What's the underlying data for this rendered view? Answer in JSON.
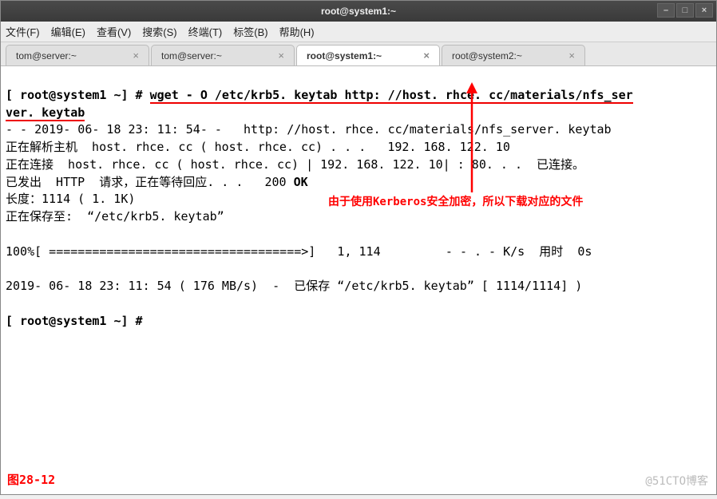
{
  "titlebar": {
    "title": "root@system1:~"
  },
  "winbuttons": {
    "min": "–",
    "max": "□",
    "close": "×"
  },
  "menu": {
    "file": "文件(F)",
    "edit": "编辑(E)",
    "view": "查看(V)",
    "search": "搜索(S)",
    "term": "终端(T)",
    "tabs": "标签(B)",
    "help": "帮助(H)"
  },
  "tabs": [
    {
      "label": "tom@server:~",
      "active": false
    },
    {
      "label": "tom@server:~",
      "active": false
    },
    {
      "label": "root@system1:~",
      "active": true
    },
    {
      "label": "root@system2:~",
      "active": false
    }
  ],
  "tab_close": "×",
  "terminal": {
    "prompt1_a": "[ root@system1 ~] # ",
    "cmd_part1": "wget - O /etc/krb5. keytab http: //host. rhce. cc/materials/nfs_ser",
    "cmd_part2": "ver. keytab",
    "l1": "- - 2019- 06- 18 23: 11: 54- -   http: //host. rhce. cc/materials/nfs_server. keytab",
    "l2": "正在解析主机  host. rhce. cc ( host. rhce. cc) . . .   192. 168. 122. 10",
    "l3": "正在连接  host. rhce. cc ( host. rhce. cc) | 192. 168. 122. 10| : 80. . .  已连接。",
    "l4_a": "已发出  HTTP  请求，正在等待回应. . .   200 ",
    "l4_b": "OK",
    "l5": "长度：1114 ( 1. 1K)",
    "l6": "正在保存至:  “/etc/krb5. keytab”",
    "l7": "100%[ ===================================>]   1, 114         - - . - K/s  用时  0s",
    "l8": "2019- 06- 18 23: 11: 54 ( 176 MB/s)  -  已保存 “/etc/krb5. keytab” [ 1114/1114] )",
    "prompt2": "[ root@system1 ~] #"
  },
  "annotation": "由于使用Kerberos安全加密，所以下载对应的文件",
  "figure_label": "图28-12",
  "watermark": "@51CTO博客"
}
